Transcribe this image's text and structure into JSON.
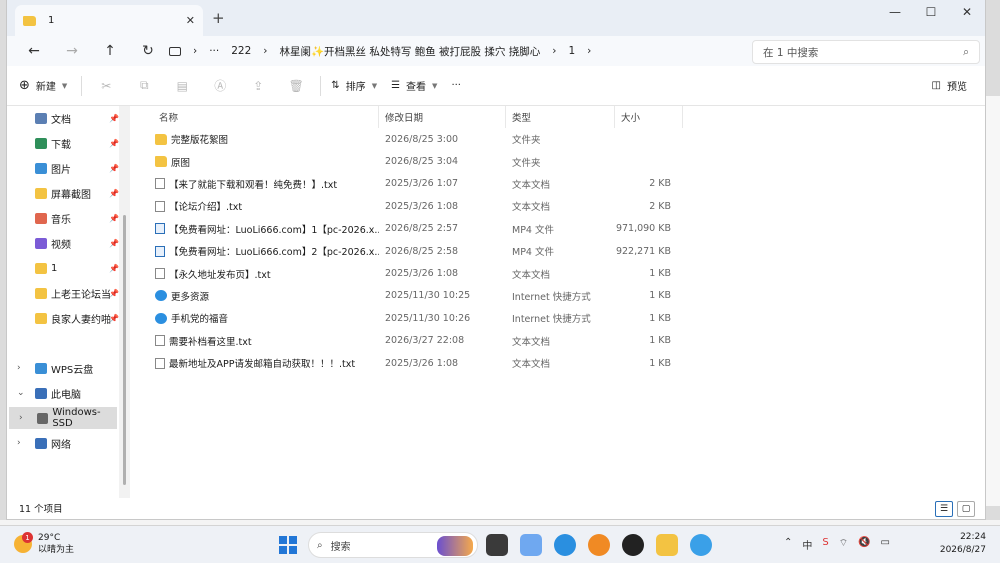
{
  "tab": {
    "title": "1",
    "close": "✕",
    "new": "+"
  },
  "window_controls": {
    "minimize": "—",
    "maximize": "☐",
    "close": "✕"
  },
  "nav": {
    "back": "←",
    "forward": "→",
    "up": "↑",
    "refresh": "↻"
  },
  "breadcrumb": [
    "›",
    "···",
    "222",
    "›",
    "林星阑✨开档黑丝 私处特写 鲍鱼 被打屁股 揉穴 挠脚心",
    "›",
    "1",
    "›"
  ],
  "search": {
    "placeholder": "在 1 中搜索"
  },
  "toolbar": {
    "new": "新建",
    "sort": "排序",
    "view": "查看",
    "more": "···",
    "preview": "预览"
  },
  "sidebar": [
    {
      "label": "文档",
      "pinned": true,
      "color": "#5b7fb3"
    },
    {
      "label": "下载",
      "pinned": true,
      "color": "#2f8f5a"
    },
    {
      "label": "图片",
      "pinned": true,
      "color": "#3a8fd6"
    },
    {
      "label": "屏幕截图",
      "pinned": true,
      "color": "#f3c342"
    },
    {
      "label": "音乐",
      "pinned": true,
      "color": "#e0664e"
    },
    {
      "label": "视频",
      "pinned": true,
      "color": "#7b5bd6"
    },
    {
      "label": "1",
      "pinned": true,
      "color": "#f3c342"
    },
    {
      "label": "上老王论坛当",
      "pinned": true,
      "color": "#f3c342"
    },
    {
      "label": "良家人妻约啪",
      "pinned": true,
      "color": "#f3c342"
    },
    {
      "label": "WPS云盘",
      "pinned": false,
      "color": "#3a8fd6",
      "chevron": "›"
    },
    {
      "label": "此电脑",
      "pinned": false,
      "color": "#3a6fb8",
      "chevron": "⌄"
    },
    {
      "label": "Windows-SSD",
      "pinned": false,
      "color": "#666666",
      "chevron": "›",
      "selected": true
    },
    {
      "label": "网络",
      "pinned": false,
      "color": "#3a6fb8",
      "chevron": "›"
    }
  ],
  "columns": {
    "name": "名称",
    "date": "修改日期",
    "type": "类型",
    "size": "大小"
  },
  "files": [
    {
      "name": "完整版花絮图",
      "date": "2026/8/25 3:00",
      "type": "文件夹",
      "size": "",
      "kind": "folder"
    },
    {
      "name": "原图",
      "date": "2026/8/25 3:04",
      "type": "文件夹",
      "size": "",
      "kind": "folder"
    },
    {
      "name": "【来了就能下载和观看！纯免费！】.txt",
      "date": "2025/3/26 1:07",
      "type": "文本文档",
      "size": "2 KB",
      "kind": "txt"
    },
    {
      "name": "【论坛介绍】.txt",
      "date": "2025/3/26 1:08",
      "type": "文本文档",
      "size": "2 KB",
      "kind": "txt"
    },
    {
      "name": "【免费看网址：LuoLi666.com】1【pc-2026.x...",
      "date": "2026/8/25 2:57",
      "type": "MP4 文件",
      "size": "971,090 KB",
      "kind": "mp4"
    },
    {
      "name": "【免费看网址：LuoLi666.com】2【pc-2026.x...",
      "date": "2026/8/25 2:58",
      "type": "MP4 文件",
      "size": "922,271 KB",
      "kind": "mp4"
    },
    {
      "name": "【永久地址发布页】.txt",
      "date": "2025/3/26 1:08",
      "type": "文本文档",
      "size": "1 KB",
      "kind": "txt"
    },
    {
      "name": "更多资源",
      "date": "2025/11/30 10:25",
      "type": "Internet 快捷方式",
      "size": "1 KB",
      "kind": "url"
    },
    {
      "name": "手机党的福音",
      "date": "2025/11/30 10:26",
      "type": "Internet 快捷方式",
      "size": "1 KB",
      "kind": "url"
    },
    {
      "name": "需要补档看这里.txt",
      "date": "2026/3/27 22:08",
      "type": "文本文档",
      "size": "1 KB",
      "kind": "txt"
    },
    {
      "name": "最新地址及APP请发邮箱自动获取！！！.txt",
      "date": "2025/3/26 1:08",
      "type": "文本文档",
      "size": "1 KB",
      "kind": "txt"
    }
  ],
  "status": {
    "count": "11 个项目"
  },
  "taskbar": {
    "weather_temp": "29°C",
    "weather_desc": "以晴为主",
    "weather_badge": "1",
    "search": "搜索",
    "ime": "中",
    "time": "22:24",
    "date": "2026/8/27"
  }
}
